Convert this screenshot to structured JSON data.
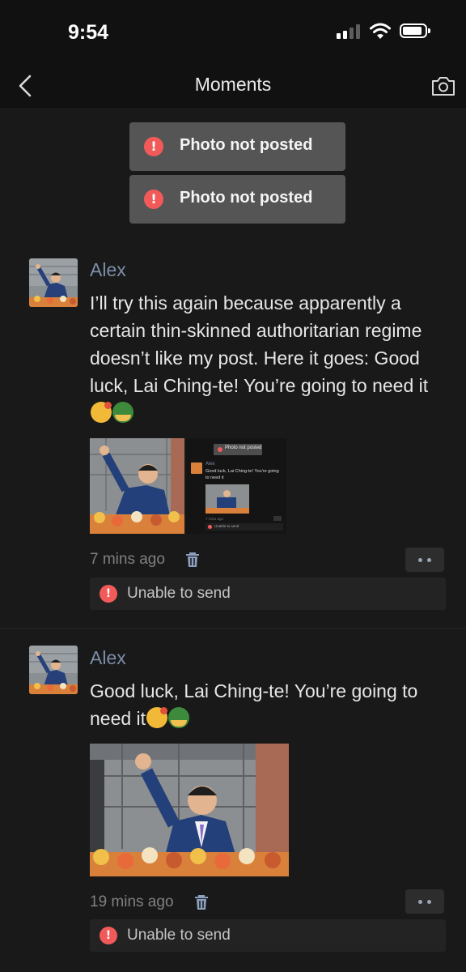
{
  "status_bar": {
    "time": "9:54"
  },
  "nav": {
    "title": "Moments",
    "back_icon": "chevron-left-icon",
    "camera_icon": "camera-icon"
  },
  "toasts": [
    "Photo not posted",
    "Photo not posted"
  ],
  "posts": [
    {
      "author": "Alex",
      "text": "I’ll try this again because apparently a certain thin-skinned authoritarian regime doesn’t like my post. Here it goes: Good luck, Lai Ching-te! You’re going to need it",
      "emojis": [
        "shushing-face-emoji",
        "military-helmet-emoji"
      ],
      "time_ago": "7 mins ago",
      "status": "Unable to send",
      "embedded_screenshot": {
        "toast": "Photo not posted",
        "author": "Alex",
        "text": "Good luck, Lai Ching-te! You're going to need it",
        "time_ago": "7 mins ago",
        "status": "Unable to send"
      }
    },
    {
      "author": "Alex",
      "text": "Good luck, Lai Ching-te! You’re going to need it",
      "emojis": [
        "shushing-face-emoji",
        "military-helmet-emoji"
      ],
      "time_ago": "19 mins ago",
      "status": "Unable to send"
    }
  ],
  "colors": {
    "background": "#191919",
    "name": "#7c8ea8",
    "error": "#f25a5a",
    "toast": "#555555"
  }
}
